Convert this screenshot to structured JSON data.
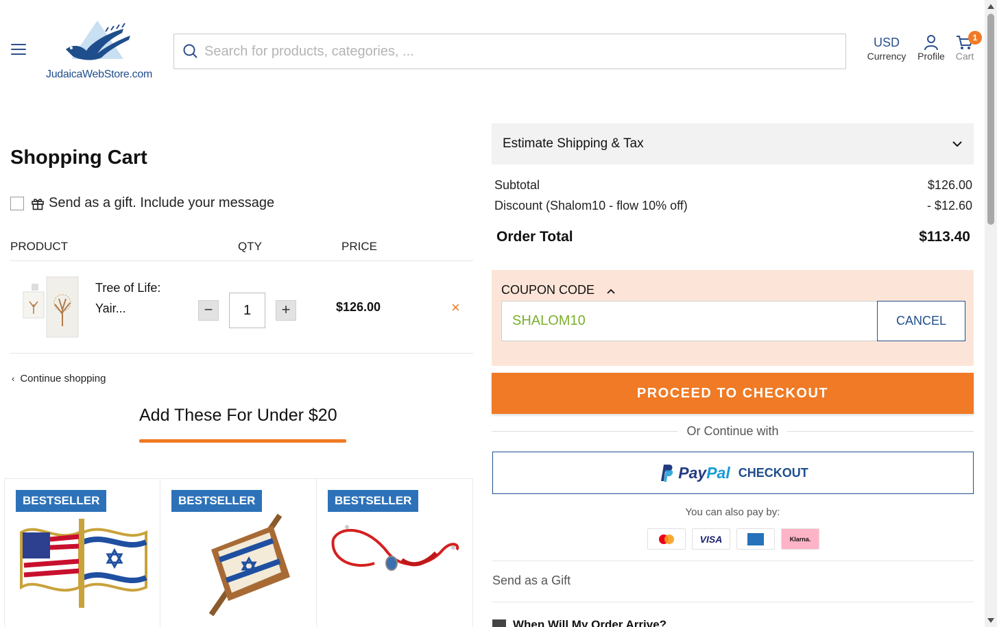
{
  "header": {
    "logo_text": "JudaicaWebStore.com",
    "search_placeholder": "Search for products, categories, ...",
    "currency_value": "USD",
    "currency_label": "Currency",
    "profile_label": "Profile",
    "cart_label": "Cart",
    "cart_count": "1"
  },
  "cart": {
    "title": "Shopping Cart",
    "gift_label": "Send as a gift. Include your message",
    "col_product": "PRODUCT",
    "col_qty": "QTY",
    "col_price": "PRICE",
    "items": [
      {
        "name_line1": "Tree of Life:",
        "name_line2": "Yair...",
        "qty": "1",
        "price": "$126.00",
        "qty_minus": "−",
        "qty_plus": "+",
        "remove_icon": "×"
      }
    ],
    "continue_label": "Continue shopping"
  },
  "upsell": {
    "title": "Add These For Under $20",
    "products": [
      {
        "badge": "BESTSELLER"
      },
      {
        "badge": "BESTSELLER"
      },
      {
        "badge": "BESTSELLER"
      }
    ]
  },
  "summary": {
    "estimate_label": "Estimate Shipping & Tax",
    "subtotal_label": "Subtotal",
    "subtotal_value": "$126.00",
    "discount_label": "Discount (Shalom10 - flow 10% off)",
    "discount_value": "- $12.60",
    "total_label": "Order Total",
    "total_value": "$113.40",
    "coupon_label": "COUPON CODE",
    "coupon_value": "SHALOM10",
    "cancel_label": "CANCEL",
    "checkout_label": "PROCEED TO CHECKOUT",
    "or_label": "Or Continue with",
    "paypal_pay": "Pay",
    "paypal_pal": "Pal",
    "paypal_checkout": "CHECKOUT",
    "also_pay_label": "You can also pay by:",
    "visa_label": "VISA",
    "klarna_label": "Klarna.",
    "send_gift_label": "Send as a Gift",
    "when_label": "When Will My Order Arrive?"
  },
  "colors": {
    "accent": "#f07a25",
    "brand": "#1f4e8c",
    "coupon_bg": "#fce5d8",
    "coupon_text": "#7bb02d",
    "badge": "#2d72b8"
  }
}
